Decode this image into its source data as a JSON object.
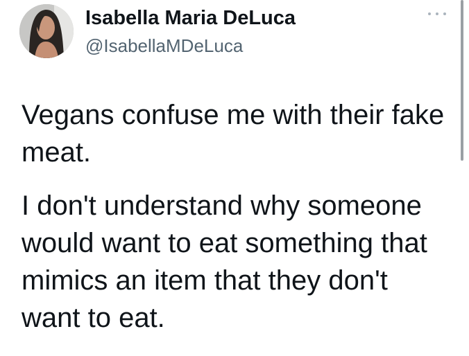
{
  "tweet": {
    "author": {
      "display_name": "Isabella Maria DeLuca",
      "handle": "@IsabellaMDeLuca",
      "avatar_icon": "profile-photo-avatar"
    },
    "more_icon": "more-options-icon",
    "paragraphs": [
      "Vegans confuse me with their fake meat.",
      "I don't understand why someone would want to eat something that mimics an item that they don't want to eat."
    ]
  },
  "colors": {
    "text": "#0f1419",
    "secondary": "#536471",
    "background": "#ffffff"
  }
}
